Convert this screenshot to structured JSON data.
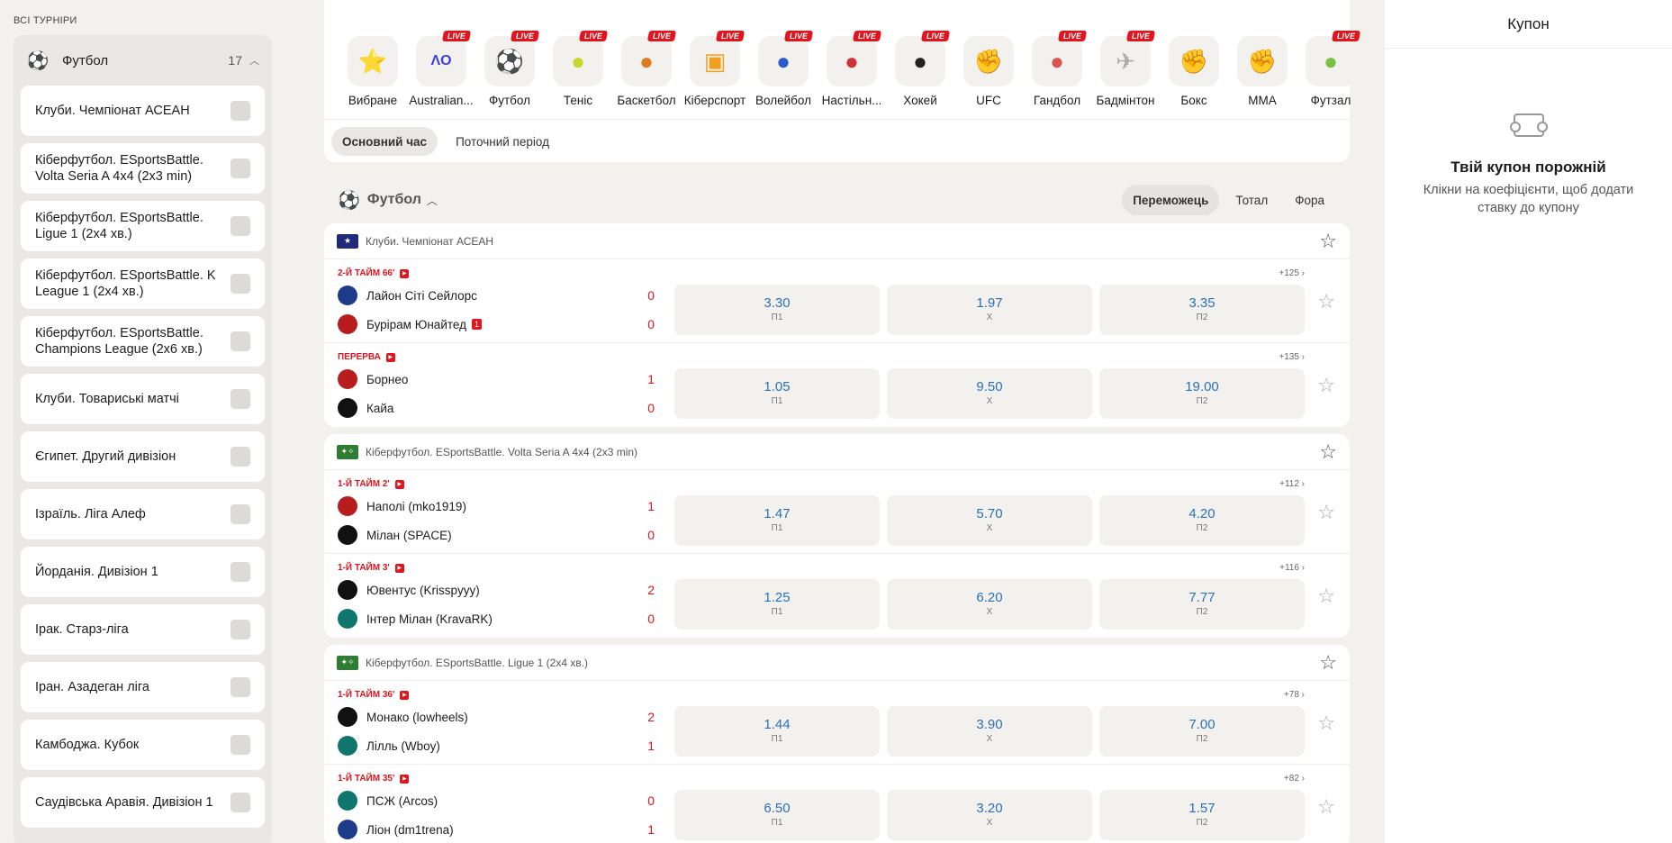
{
  "left": {
    "title": "ВСІ ТУРНІРИ",
    "sport": {
      "name": "Футбол",
      "count": "17"
    },
    "tournaments": [
      "Клуби. Чемпіонат АСЕАН",
      "Кіберфутбол. ESportsBattle. Volta Seria A 4x4 (2x3 min)",
      "Кіберфутбол. ESportsBattle. Ligue 1 (2x4 хв.)",
      "Кіберфутбол. ESportsBattle. K League 1 (2x4 хв.)",
      "Кіберфутбол. ESportsBattle. Champions League (2x6 хв.)",
      "Клуби. Товариські матчі",
      "Єгипет. Другий дивізіон",
      "Ізраїль. Ліга Алеф",
      "Йорданія. Дивізіон 1",
      "Ірак. Старз-ліга",
      "Іран. Азадеган ліга",
      "Камбоджа. Кубок",
      "Саудівська Аравія. Дивізіон 1"
    ]
  },
  "categories": [
    {
      "label": "Вибране",
      "icon": "star",
      "live": false
    },
    {
      "label": "Australian...",
      "icon": "tennis-ao",
      "live": true
    },
    {
      "label": "Футбол",
      "icon": "soccer",
      "live": true
    },
    {
      "label": "Теніс",
      "icon": "tennis",
      "live": true
    },
    {
      "label": "Баскетбол",
      "icon": "basketball",
      "live": true
    },
    {
      "label": "Кіберспорт",
      "icon": "gamepad",
      "live": true
    },
    {
      "label": "Волейбол",
      "icon": "volleyball",
      "live": true
    },
    {
      "label": "Настільн...",
      "icon": "table-tennis",
      "live": true
    },
    {
      "label": "Хокей",
      "icon": "hockey",
      "live": true
    },
    {
      "label": "UFC",
      "icon": "ufc-glove",
      "live": false
    },
    {
      "label": "Гандбол",
      "icon": "handball",
      "live": true
    },
    {
      "label": "Бадмінтон",
      "icon": "shuttlecock",
      "live": true
    },
    {
      "label": "Бокс",
      "icon": "boxing-glove",
      "live": false
    },
    {
      "label": "MMA",
      "icon": "mma-glove",
      "live": false
    },
    {
      "label": "Футзал",
      "icon": "futsal",
      "live": true
    }
  ],
  "live_badge": "LIVE",
  "period_tabs": [
    "Основний час",
    "Поточний період"
  ],
  "section": {
    "title": "Футбол"
  },
  "market_tabs": [
    "Переможець",
    "Тотал",
    "Фора"
  ],
  "tournament_cards": [
    {
      "name": "Клуби. Чемпіонат АСЕАН",
      "flag_color": "#1f2a7a",
      "matches": [
        {
          "status": "2-Й ТАЙМ 66'",
          "more": "+125 ›",
          "home": "Лайон Сіті Сейлорс",
          "away": "Бурірам Юнайтед",
          "home_score": "0",
          "away_score": "0",
          "away_red": "1",
          "odds": [
            "3.30",
            "1.97",
            "3.35"
          ]
        },
        {
          "status": "ПЕРЕРВА",
          "more": "+135 ›",
          "home": "Борнео",
          "away": "Кайа",
          "home_score": "1",
          "away_score": "0",
          "away_red": "",
          "odds": [
            "1.05",
            "9.50",
            "19.00"
          ]
        }
      ]
    },
    {
      "name": "Кіберфутбол. ESportsBattle. Volta Seria A 4x4 (2x3 min)",
      "flag_color": "#2e7d32",
      "matches": [
        {
          "status": "1-Й ТАЙМ 2'",
          "more": "+112 ›",
          "home": "Наполі (mko1919)",
          "away": "Мілан (SPACE)",
          "home_score": "1",
          "away_score": "0",
          "away_red": "",
          "odds": [
            "1.47",
            "5.70",
            "4.20"
          ]
        },
        {
          "status": "1-Й ТАЙМ 3'",
          "more": "+116 ›",
          "home": "Ювентус (Krisspyyy)",
          "away": "Інтер Мілан (KravaRK)",
          "home_score": "2",
          "away_score": "0",
          "away_red": "",
          "odds": [
            "1.25",
            "6.20",
            "7.77"
          ]
        }
      ]
    },
    {
      "name": "Кіберфутбол. ESportsBattle. Ligue 1 (2x4 хв.)",
      "flag_color": "#2e7d32",
      "matches": [
        {
          "status": "1-Й ТАЙМ 36'",
          "more": "+78 ›",
          "home": "Монако (lowheels)",
          "away": "Лілль (Wboy)",
          "home_score": "2",
          "away_score": "1",
          "away_red": "",
          "odds": [
            "1.44",
            "3.90",
            "7.00"
          ]
        },
        {
          "status": "1-Й ТАЙМ 35'",
          "more": "+82 ›",
          "home": "ПСЖ (Arcos)",
          "away": "Ліон (dm1trena)",
          "home_score": "0",
          "away_score": "1",
          "away_red": "",
          "odds": [
            "6.50",
            "3.20",
            "1.57"
          ]
        }
      ]
    }
  ],
  "odds_labels": [
    "П1",
    "Х",
    "П2"
  ],
  "coupon": {
    "title": "Купон",
    "empty_title": "Твій купон порожній",
    "empty_text": "Клікни на коефіцієнти, щоб додати ставку до купону"
  }
}
